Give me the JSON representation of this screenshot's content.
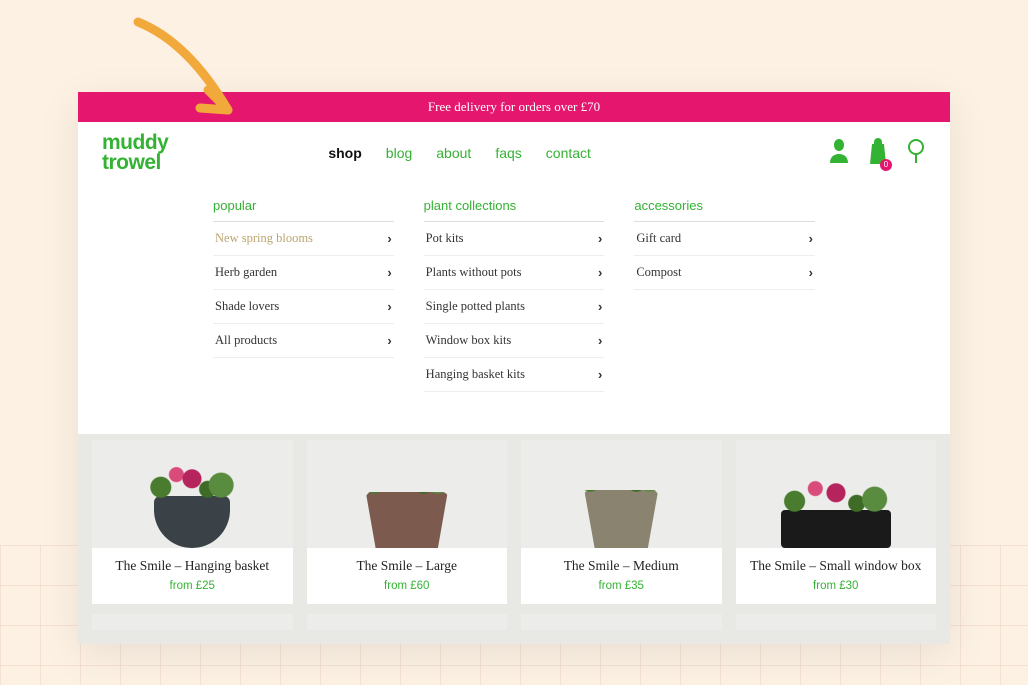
{
  "banner": {
    "text": "Free delivery for orders over £70"
  },
  "logo": {
    "line1": "muddy",
    "line2": "trowel"
  },
  "nav": {
    "items": [
      {
        "label": "shop",
        "active": true
      },
      {
        "label": "blog",
        "active": false
      },
      {
        "label": "about",
        "active": false
      },
      {
        "label": "faqs",
        "active": false
      },
      {
        "label": "contact",
        "active": false
      }
    ]
  },
  "cart": {
    "count": "0"
  },
  "mega": {
    "columns": [
      {
        "heading": "popular",
        "items": [
          {
            "label": "New spring blooms",
            "highlight": true
          },
          {
            "label": "Herb garden"
          },
          {
            "label": "Shade lovers"
          },
          {
            "label": "All products"
          }
        ]
      },
      {
        "heading": "plant collections",
        "items": [
          {
            "label": "Pot kits"
          },
          {
            "label": "Plants without pots"
          },
          {
            "label": "Single potted plants"
          },
          {
            "label": "Window box kits"
          },
          {
            "label": "Hanging basket kits"
          }
        ]
      },
      {
        "heading": "accessories",
        "items": [
          {
            "label": "Gift card"
          },
          {
            "label": "Compost"
          }
        ]
      }
    ]
  },
  "products": [
    {
      "title": "The Smile – Hanging basket",
      "price": "from £25",
      "pot": "dark"
    },
    {
      "title": "The Smile – Large",
      "price": "from £60",
      "pot": "terra"
    },
    {
      "title": "The Smile – Medium",
      "price": "from £35",
      "pot": "taupe"
    },
    {
      "title": "The Smile – Small window box",
      "price": "from £30",
      "pot": "box"
    }
  ]
}
